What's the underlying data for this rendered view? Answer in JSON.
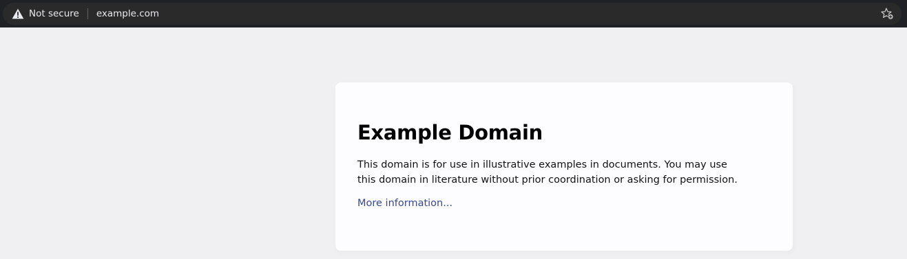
{
  "browser": {
    "security_label": "Not secure",
    "url": "example.com",
    "icons": {
      "security": "warning-icon",
      "bookmark": "bookmark-star-icon"
    },
    "colors": {
      "chrome_bg": "#202124",
      "omnibox_bg": "#2a2a2a",
      "text": "#e8eaed"
    }
  },
  "page": {
    "title": "Example Domain",
    "body": "This domain is for use in illustrative examples in documents. You may use this domain in literature without prior coordination or asking for permission.",
    "link_text": "More information...",
    "colors": {
      "background": "#f0f0f2",
      "card": "#fdfdff",
      "link": "#38488f"
    }
  }
}
